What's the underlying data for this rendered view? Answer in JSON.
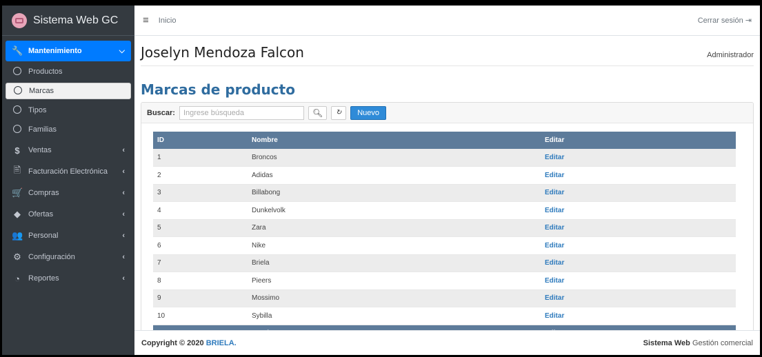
{
  "app": {
    "title": "Sistema Web GC"
  },
  "sidebar": {
    "items": [
      {
        "label": "Mantenimiento",
        "icon": "wrench-icon"
      },
      {
        "label": "Productos"
      },
      {
        "label": "Marcas"
      },
      {
        "label": "Tipos"
      },
      {
        "label": "Familias"
      },
      {
        "label": "Ventas",
        "icon": "dollar-icon"
      },
      {
        "label": "Facturación Electrónica",
        "icon": "invoice-icon"
      },
      {
        "label": "Compras",
        "icon": "cart-icon"
      },
      {
        "label": "Ofertas",
        "icon": "tags-icon"
      },
      {
        "label": "Personal",
        "icon": "users-icon"
      },
      {
        "label": "Configuración",
        "icon": "gear-icon"
      },
      {
        "label": "Reportes",
        "icon": "pie-chart-icon"
      }
    ]
  },
  "topbar": {
    "breadcrumb": "Inicio",
    "logout": "Cerrar sesión"
  },
  "user": {
    "name": "Joselyn Mendoza Falcon",
    "role": "Administrador"
  },
  "page": {
    "title": "Marcas de producto"
  },
  "search": {
    "label": "Buscar:",
    "placeholder": "Ingrese búsqueda",
    "new_button": "Nuevo"
  },
  "table": {
    "headers": [
      "ID",
      "Nombre",
      "Editar"
    ],
    "rows": [
      {
        "id": "1",
        "nombre": "Broncos",
        "edit": "Editar"
      },
      {
        "id": "2",
        "nombre": "Adidas",
        "edit": "Editar"
      },
      {
        "id": "3",
        "nombre": "Billabong",
        "edit": "Editar"
      },
      {
        "id": "4",
        "nombre": "Dunkelvolk",
        "edit": "Editar"
      },
      {
        "id": "5",
        "nombre": "Zara",
        "edit": "Editar"
      },
      {
        "id": "6",
        "nombre": "Nike",
        "edit": "Editar"
      },
      {
        "id": "7",
        "nombre": "Briela",
        "edit": "Editar"
      },
      {
        "id": "8",
        "nombre": "Pieers",
        "edit": "Editar"
      },
      {
        "id": "9",
        "nombre": "Mossimo",
        "edit": "Editar"
      },
      {
        "id": "10",
        "nombre": "Sybilla",
        "edit": "Editar"
      }
    ]
  },
  "footer": {
    "copyright_prefix": "Copyright © 2020",
    "copyright_brand": "BRIELA.",
    "right_bold": "Sistema Web",
    "right_text": "Gestión comercial"
  },
  "colors": {
    "sidebar": "#343a40",
    "accent": "#007bff",
    "table_header": "#5d7b9a",
    "title": "#2f6c9f"
  }
}
